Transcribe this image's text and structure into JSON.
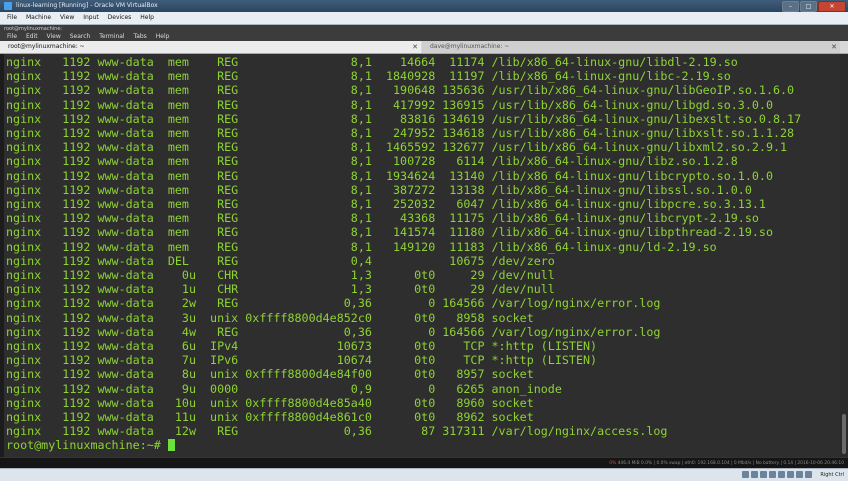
{
  "vbox": {
    "title": "linux-learning [Running] - Oracle VM VirtualBox",
    "menu": [
      "File",
      "Machine",
      "View",
      "Input",
      "Devices",
      "Help"
    ],
    "host_key": "Right Ctrl"
  },
  "terminal_window": {
    "hostname_label": "root@mylinuxmachine:",
    "menu": [
      "File",
      "Edit",
      "View",
      "Search",
      "Terminal",
      "Tabs",
      "Help"
    ]
  },
  "tabs": [
    {
      "label": "root@mylinuxmachine: ~",
      "active": true
    },
    {
      "label": "dave@mylinuxmachine: ~",
      "active": false
    }
  ],
  "lines": [
    "nginx   1192 www-data  mem    REG                8,1    14664  11174 /lib/x86_64-linux-gnu/libdl-2.19.so",
    "nginx   1192 www-data  mem    REG                8,1  1840928  11197 /lib/x86_64-linux-gnu/libc-2.19.so",
    "nginx   1192 www-data  mem    REG                8,1   190648 135636 /usr/lib/x86_64-linux-gnu/libGeoIP.so.1.6.0",
    "nginx   1192 www-data  mem    REG                8,1   417992 136915 /usr/lib/x86_64-linux-gnu/libgd.so.3.0.0",
    "nginx   1192 www-data  mem    REG                8,1    83816 134619 /usr/lib/x86_64-linux-gnu/libexslt.so.0.8.17",
    "nginx   1192 www-data  mem    REG                8,1   247952 134618 /usr/lib/x86_64-linux-gnu/libxslt.so.1.1.28",
    "nginx   1192 www-data  mem    REG                8,1  1465592 132677 /usr/lib/x86_64-linux-gnu/libxml2.so.2.9.1",
    "nginx   1192 www-data  mem    REG                8,1   100728   6114 /lib/x86_64-linux-gnu/libz.so.1.2.8",
    "nginx   1192 www-data  mem    REG                8,1  1934624  13140 /lib/x86_64-linux-gnu/libcrypto.so.1.0.0",
    "nginx   1192 www-data  mem    REG                8,1   387272  13138 /lib/x86_64-linux-gnu/libssl.so.1.0.0",
    "nginx   1192 www-data  mem    REG                8,1   252032   6047 /lib/x86_64-linux-gnu/libpcre.so.3.13.1",
    "nginx   1192 www-data  mem    REG                8,1    43368  11175 /lib/x86_64-linux-gnu/libcrypt-2.19.so",
    "nginx   1192 www-data  mem    REG                8,1   141574  11180 /lib/x86_64-linux-gnu/libpthread-2.19.so",
    "nginx   1192 www-data  mem    REG                8,1   149120  11183 /lib/x86_64-linux-gnu/ld-2.19.so",
    "nginx   1192 www-data  DEL    REG                0,4           10675 /dev/zero",
    "nginx   1192 www-data    0u   CHR                1,3      0t0     29 /dev/null",
    "nginx   1192 www-data    1u   CHR                1,3      0t0     29 /dev/null",
    "nginx   1192 www-data    2w   REG               0,36        0 164566 /var/log/nginx/error.log",
    "nginx   1192 www-data    3u  unix 0xffff8800d4e852c0      0t0   8958 socket",
    "nginx   1192 www-data    4w   REG               0,36        0 164566 /var/log/nginx/error.log",
    "nginx   1192 www-data    6u  IPv4              10673      0t0    TCP *:http (LISTEN)",
    "nginx   1192 www-data    7u  IPv6              10674      0t0    TCP *:http (LISTEN)",
    "nginx   1192 www-data    8u  unix 0xffff8800d4e84f00      0t0   8957 socket",
    "nginx   1192 www-data    9u  0000                0,9        0   6265 anon_inode",
    "nginx   1192 www-data   10u  unix 0xffff8800d4e85a40      0t0   8960 socket",
    "nginx   1192 www-data   11u  unix 0xffff8800d4e861c0      0t0   8962 socket",
    "nginx   1192 www-data   12w   REG               0,36       87 317311 /var/log/nginx/access.log"
  ],
  "prompt": "root@mylinuxmachine:~# ",
  "guest_status": {
    "cpu": "0%",
    "mem": "446.4 MiB",
    "other": "0.0% | 0.0% swap | eth0: 192.168.0.104 | 0 Mbit/s | No battery | 0.14 | 2016-10-06 20:46:10"
  },
  "colors": {
    "terminal_text": "#8ed334",
    "terminal_bg": "#2e2e2e",
    "cursor": "#6ee03a"
  }
}
